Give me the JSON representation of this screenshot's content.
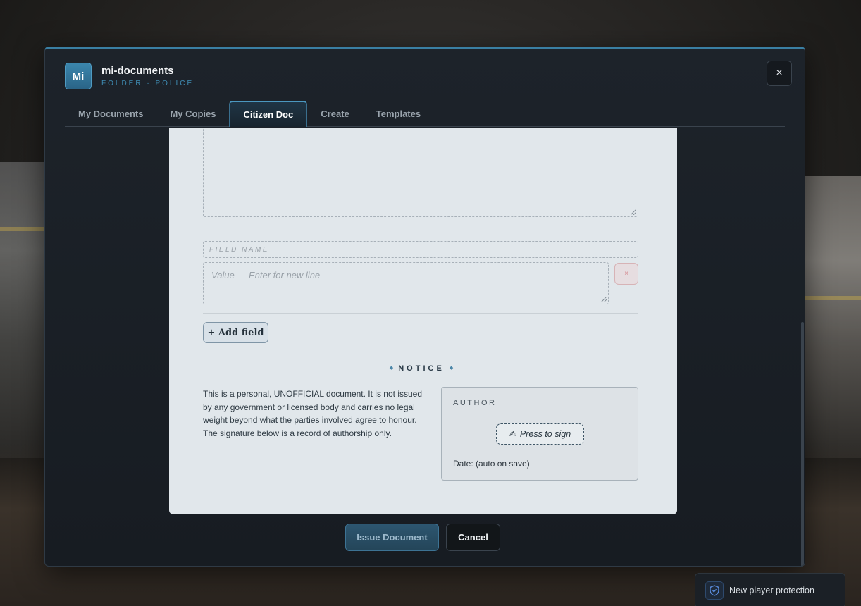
{
  "app": {
    "badge": "Mi",
    "title": "mi-documents",
    "subtitle": "FOLDER · POLICE",
    "close_label": "×",
    "accent_color": "#3a7fa3"
  },
  "tabs": [
    {
      "label": "My Documents",
      "active": false
    },
    {
      "label": "My Copies",
      "active": false
    },
    {
      "label": "Citizen Doc",
      "active": true
    },
    {
      "label": "Create",
      "active": false
    },
    {
      "label": "Templates",
      "active": false
    }
  ],
  "form": {
    "field_name_placeholder": "FIELD NAME",
    "field_value_placeholder": "Value — Enter for new line",
    "remove_label": "×",
    "add_field_label": "+ Add field"
  },
  "notice": {
    "heading": "NOTICE",
    "body": "This is a personal, UNOFFICIAL document. It is not issued by any government or licensed body and carries no legal weight beyond what the parties involved agree to honour. The signature below is a record of authorship only."
  },
  "author": {
    "label": "AUTHOR",
    "sign_icon": "✍",
    "sign_label": "Press to sign",
    "date_text": "Date: (auto on save)"
  },
  "actions": {
    "issue_label": "Issue Document",
    "cancel_label": "Cancel"
  },
  "toast": {
    "icon": "shield-icon",
    "text": "New player protection"
  }
}
